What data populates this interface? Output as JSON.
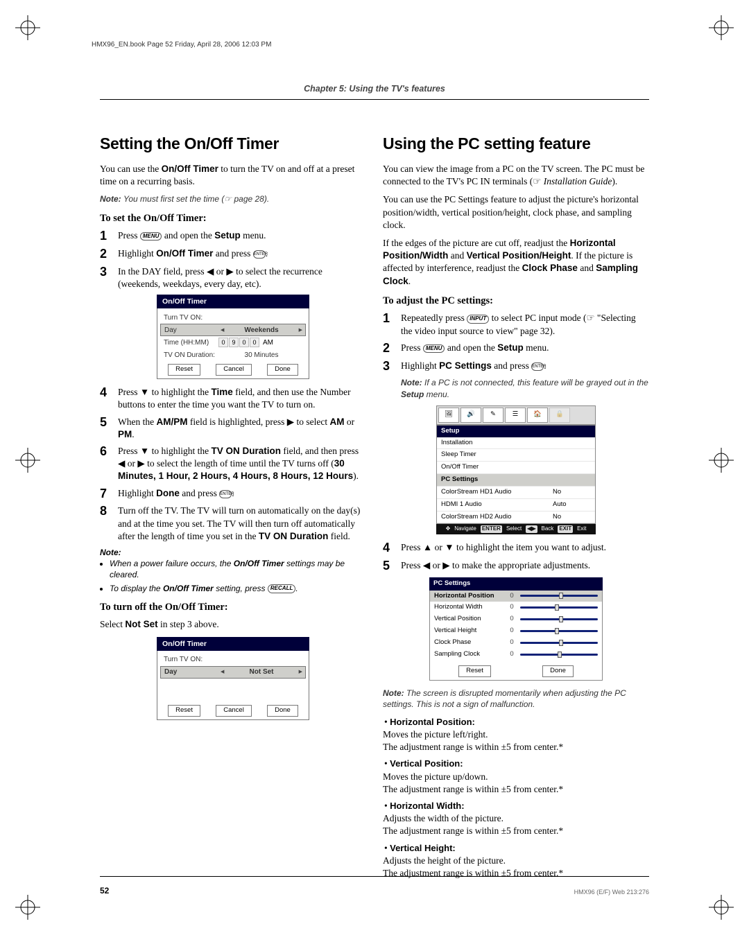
{
  "doc_header": "HMX96_EN.book  Page 52  Friday, April 28, 2006  12:03 PM",
  "chapter": "Chapter 5: Using the TV's features",
  "page_number": "52",
  "footer_id": "HMX96 (E/F) Web 213:276",
  "left": {
    "title": "Setting the On/Off Timer",
    "intro_a": "You can use the ",
    "intro_b": "On/Off Timer",
    "intro_c": " to turn the TV on and off at a preset time on a recurring basis.",
    "note1_label": "Note: ",
    "note1_text": "You must first set the time (☞ page 28).",
    "proc1": "To set the On/Off Timer:",
    "steps1": {
      "s1": {
        "n": "1",
        "a": "Press ",
        "btn": "MENU",
        "b": " and open the ",
        "bold": "Setup",
        "c": " menu."
      },
      "s2": {
        "n": "2",
        "a": "Highlight ",
        "bold": "On/Off Timer",
        "b": " and press ",
        "btn": "ENTER",
        "c": "."
      },
      "s3": {
        "n": "3",
        "a": "In the DAY field, press ◀ or ▶ to select the recurrence (weekends, weekdays, every day, etc)."
      }
    },
    "osd1": {
      "title": "On/Off Timer",
      "group_label": "Turn TV ON:",
      "rows": {
        "day": {
          "label": "Day",
          "value": "Weekends"
        },
        "time": {
          "label": "Time (HH:MM)",
          "cells": [
            "0",
            "9",
            "0",
            "0"
          ],
          "ampm": "AM"
        },
        "dur": {
          "label": "TV ON Duration:",
          "value": "30 Minutes"
        }
      },
      "btns": {
        "reset": "Reset",
        "cancel": "Cancel",
        "done": "Done"
      }
    },
    "steps2": {
      "s4": {
        "n": "4",
        "a": "Press ▼ to highlight the ",
        "bold": "Time",
        "b": " field, and then use the Number buttons to enter the time you want the TV to turn on."
      },
      "s5": {
        "n": "5",
        "a": "When the ",
        "bold": "AM/PM",
        "b": " field is highlighted, press ▶ to select ",
        "bold2": "AM",
        "c": " or ",
        "bold3": "PM",
        "d": "."
      },
      "s6": {
        "n": "6",
        "a": "Press ▼ to highlight the ",
        "bold": "TV ON Duration",
        "b": " field, and then press ◀ or ▶ to select the length of time until the TV turns off (",
        "list": "30 Minutes, 1 Hour, 2 Hours, 4 Hours, 8 Hours, 12 Hours",
        "c": ")."
      },
      "s7": {
        "n": "7",
        "a": "Highlight ",
        "bold": "Done",
        "b": " and press ",
        "btn": "ENTER",
        "c": "."
      },
      "s8": {
        "n": "8",
        "a": "Turn off the TV. The TV will turn on automatically on the day(s) and at the time you set. The TV will then turn off automatically after the length of time you set in the ",
        "bold": "TV ON Duration",
        "b": " field."
      }
    },
    "note2_label": "Note:",
    "note2_items": {
      "a1": "When a power failure occurs, the ",
      "a1b": "On/Off Timer",
      "a1c": " settings may be cleared.",
      "b1": "To display the ",
      "b1b": "On/Off Timer",
      "b1c": " setting, press ",
      "b1btn": "RECALL",
      "b1d": "."
    },
    "proc2": "To turn off the On/Off Timer:",
    "proc2_text_a": "Select ",
    "proc2_text_b": "Not Set",
    "proc2_text_c": " in step 3 above.",
    "osd2": {
      "title": "On/Off Timer",
      "group_label": "Turn TV ON:",
      "day_label": "Day",
      "day_value": "Not Set",
      "btns": {
        "reset": "Reset",
        "cancel": "Cancel",
        "done": "Done"
      }
    }
  },
  "right": {
    "title": "Using the PC setting feature",
    "p1": "You can view the image from a PC on the TV screen. The PC must be connected to the TV's PC IN terminals (☞ ",
    "p1_i": "Installation Guide",
    "p1_b": ").",
    "p2": "You can use the PC Settings feature to adjust the picture's horizontal position/width, vertical position/height, clock phase, and sampling clock.",
    "p3_a": "If the edges of the picture are cut off, readjust the ",
    "p3_b1": "Horizontal Position/Width",
    "p3_b": " and ",
    "p3_b2": "Vertical Position/Height",
    "p3_c": ". If the picture is affected by interference, readjust the ",
    "p3_b3": "Clock Phase",
    "p3_d": " and ",
    "p3_b4": "Sampling Clock",
    "p3_e": ".",
    "proc": "To adjust the PC settings:",
    "steps": {
      "s1": {
        "n": "1",
        "a": "Repeatedly press ",
        "btn": "INPUT",
        "b": " to select PC input mode (☞ \"Selecting the video input source to view\" page 32)."
      },
      "s2": {
        "n": "2",
        "a": "Press ",
        "btn": "MENU",
        "b": " and open the ",
        "bold": "Setup",
        "c": " menu."
      },
      "s3": {
        "n": "3",
        "a": "Highlight ",
        "bold": "PC Settings",
        "b": " and press ",
        "btn": "ENTER",
        "c": "."
      }
    },
    "note1_lab": "Note: ",
    "note1_txt_a": "If a PC is not connected, this feature will be grayed out in the ",
    "note1_bold": "Setup",
    "note1_txt_b": " menu.",
    "osd_setup": {
      "title": "Setup",
      "rows": {
        "r1": "Installation",
        "r2": "Sleep Timer",
        "r3": "On/Off Timer",
        "r4": "PC Settings",
        "r5l": "ColorStream HD1 Audio",
        "r5r": "No",
        "r6l": "HDMI 1 Audio",
        "r6r": "Auto",
        "r7l": "ColorStream HD2 Audio",
        "r7r": "No"
      },
      "legend": {
        "nav": "Navigate",
        "sel": "Select",
        "back": "Back",
        "exit": "Exit",
        "b_enter": "ENTER",
        "b_back": "◀▶",
        "b_exit": "EXIT"
      }
    },
    "steps2": {
      "s4": {
        "n": "4",
        "a": "Press ▲ or ▼ to highlight the item you want to adjust."
      },
      "s5": {
        "n": "5",
        "a": "Press ◀ or ▶ to make the appropriate adjustments."
      }
    },
    "osd_pcs": {
      "title": "PC Settings",
      "rows": {
        "r1": {
          "l": "Horizontal Position",
          "v": "0",
          "p": 50
        },
        "r2": {
          "l": "Horizontal Width",
          "v": "0",
          "p": 45
        },
        "r3": {
          "l": "Vertical Position",
          "v": "0",
          "p": 50
        },
        "r4": {
          "l": "Vertical Height",
          "v": "0",
          "p": 45
        },
        "r5": {
          "l": "Clock Phase",
          "v": "0",
          "p": 50
        },
        "r6": {
          "l": "Sampling Clock",
          "v": "0",
          "p": 48
        }
      },
      "btns": {
        "reset": "Reset",
        "done": "Done"
      }
    },
    "note2_lab": "Note: ",
    "note2_txt": "The screen is disrupted momentarily when adjusting the PC settings. This is not a sign of malfunction.",
    "desc": {
      "i1": {
        "h": "Horizontal Position:",
        "a": "Moves the picture left/right.",
        "b": "The adjustment range is within ±5 from center.*"
      },
      "i2": {
        "h": "Vertical Position:",
        "a": "Moves the picture up/down.",
        "b": "The adjustment range is within ±5 from center.*"
      },
      "i3": {
        "h": "Horizontal Width:",
        "a": "Adjusts the width of the picture.",
        "b": "The adjustment range is within ±5 from center.*"
      },
      "i4": {
        "h": "Vertical Height:",
        "a": "Adjusts the height of the picture.",
        "b": "The adjustment range is within ±5 from center.*"
      }
    }
  }
}
